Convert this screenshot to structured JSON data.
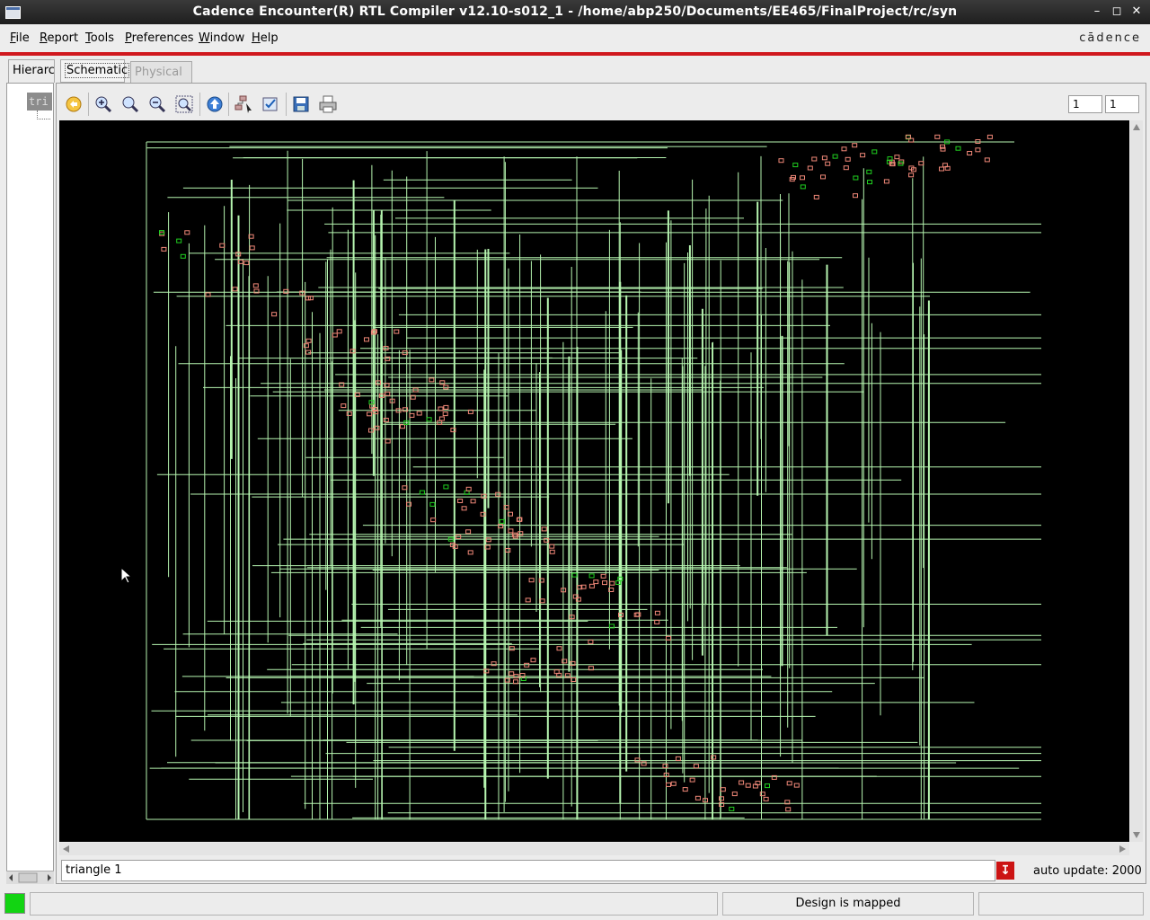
{
  "window": {
    "title": "Cadence Encounter(R) RTL Compiler v12.10-s012_1 - /home/abp250/Documents/EE465/FinalProject/rc/syn"
  },
  "menubar": {
    "items": [
      {
        "label": "File",
        "mnemonic": "F",
        "rest": "ile"
      },
      {
        "label": "Report",
        "mnemonic": "R",
        "rest": "eport"
      },
      {
        "label": "Tools",
        "mnemonic": "T",
        "rest": "ools"
      },
      {
        "label": "Preferences",
        "mnemonic": "P",
        "rest": "references"
      },
      {
        "label": "Window",
        "mnemonic": "W",
        "rest": "indow"
      },
      {
        "label": "Help",
        "mnemonic": "H",
        "rest": "elp"
      }
    ],
    "logo": "cādence",
    "accent": "#d0181e"
  },
  "tabs": {
    "hierarchy": "Hierarchy",
    "schematic": "Schematic",
    "physical": "Physical"
  },
  "tree": {
    "root_label": "tri"
  },
  "toolbar": {
    "icons": [
      "back-icon",
      "zoom-in-icon",
      "zoom-icon",
      "zoom-out-icon",
      "zoom-fit-icon",
      "up-level-icon",
      "hierarchy-select-icon",
      "select-icon",
      "save-icon",
      "print-icon"
    ],
    "page_current": "1",
    "page_total": "1"
  },
  "schematic": {
    "background": "#000000",
    "wire_color": "#b6f5b0",
    "cell_color": "#f08878",
    "pin_color": "#20d020"
  },
  "status": {
    "field_text": "triangle 1",
    "auto_update": "auto update: 2000",
    "bottom_message": "Design is mapped",
    "indicator_color": "#12d412"
  }
}
